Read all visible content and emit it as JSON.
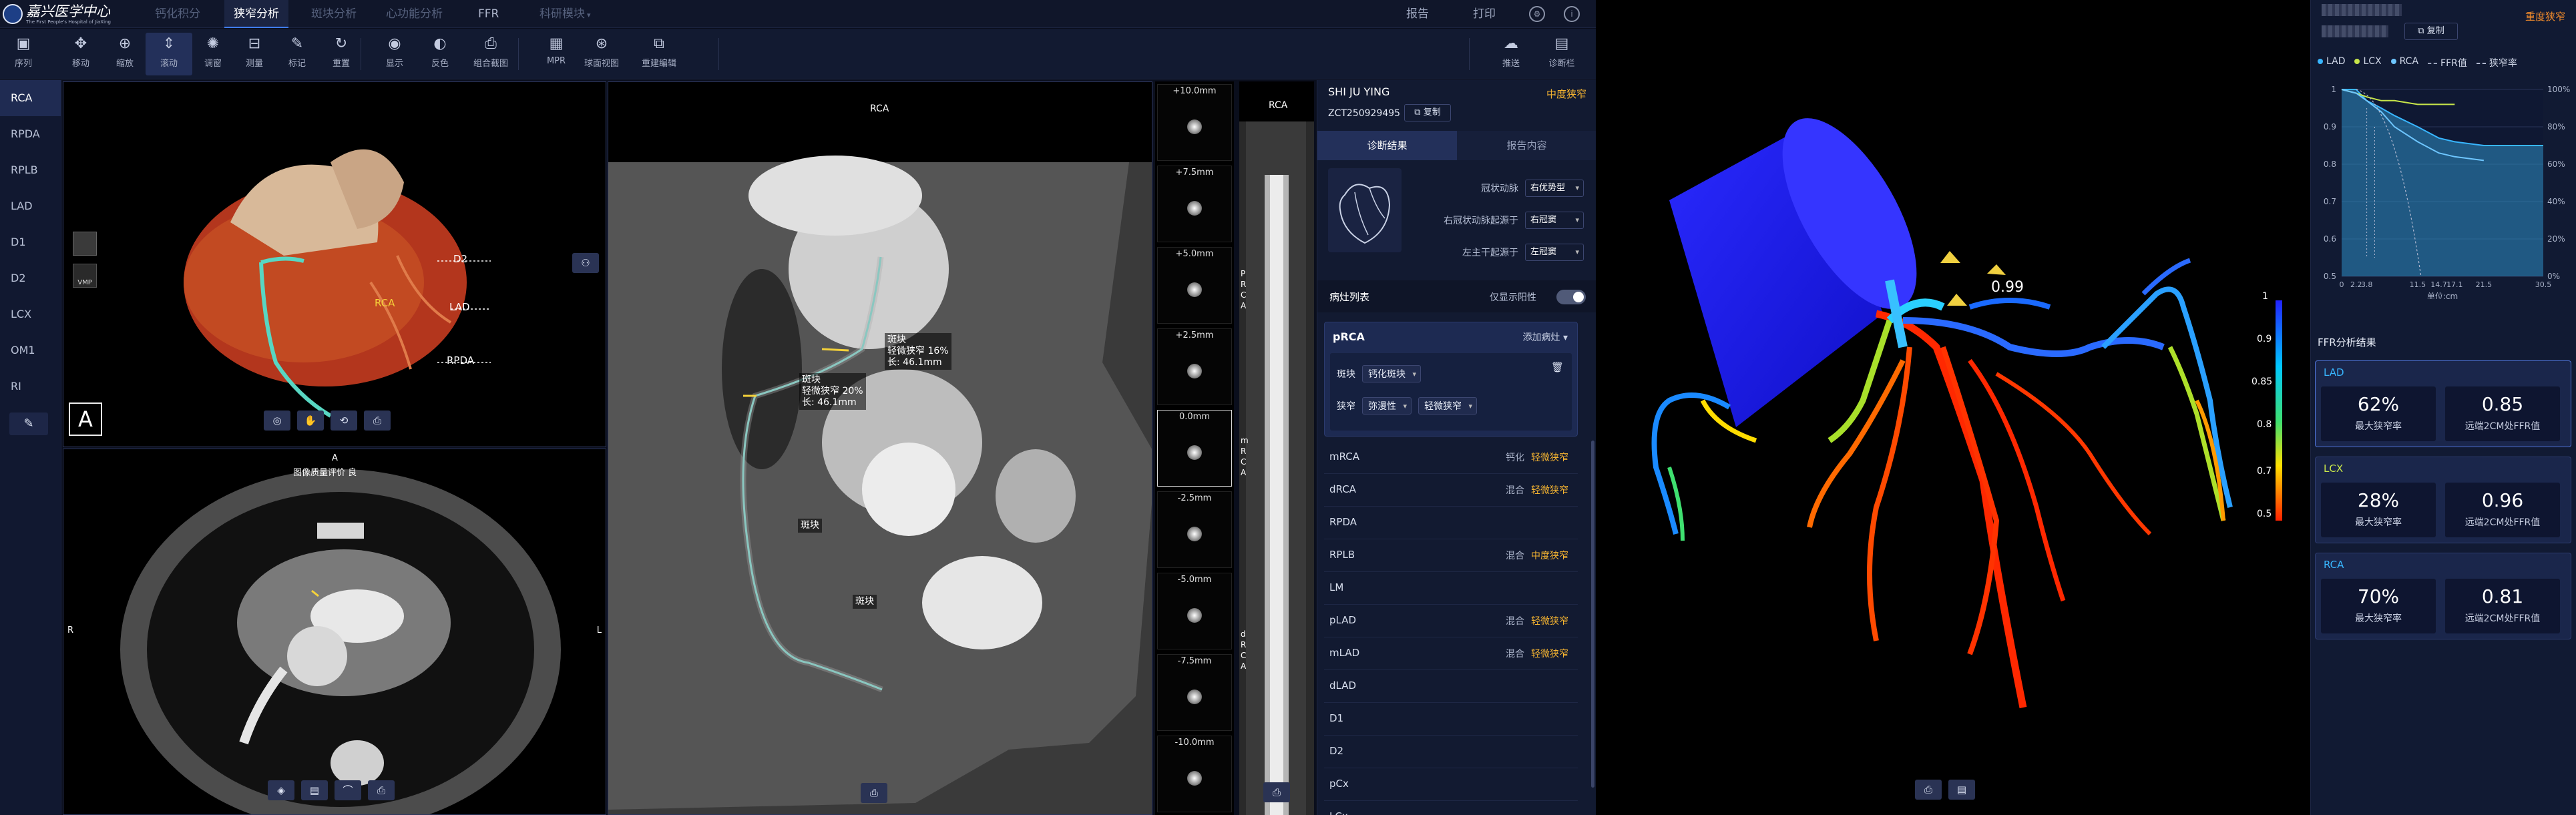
{
  "nav": {
    "logo_name": "嘉兴医学中心",
    "logo_sub": "The First People's Hospital of JiaXing",
    "tabs": [
      "钙化积分",
      "狭窄分析",
      "斑块分析",
      "心功能分析",
      "FFR",
      "科研模块"
    ],
    "right": [
      "报告",
      "打印"
    ]
  },
  "toolbar": [
    {
      "icon": "series-icon",
      "glyph": "▣",
      "label": "序列"
    },
    {
      "icon": "move-icon",
      "glyph": "✥",
      "label": "移动"
    },
    {
      "icon": "zoom-icon",
      "glyph": "⊕",
      "label": "缩放"
    },
    {
      "icon": "scroll-icon",
      "glyph": "⇕",
      "label": "滚动"
    },
    {
      "icon": "adjust-icon",
      "glyph": "✺",
      "label": "调窗"
    },
    {
      "icon": "measure-icon",
      "glyph": "⊟",
      "label": "测量"
    },
    {
      "icon": "annotate-icon",
      "glyph": "✎",
      "label": "标记"
    },
    {
      "icon": "reset-icon",
      "glyph": "↻",
      "label": "重置"
    },
    {
      "icon": "display-icon",
      "glyph": "◉",
      "label": "显示"
    },
    {
      "icon": "invert-icon",
      "glyph": "◐",
      "label": "反色"
    },
    {
      "icon": "screenshot-icon",
      "glyph": "⎙",
      "label": "组合截图"
    },
    {
      "icon": "mpr-icon",
      "glyph": "▦",
      "label": "MPR"
    },
    {
      "icon": "sphere-icon",
      "glyph": "⊛",
      "label": "球面视图"
    },
    {
      "icon": "rebuild-icon",
      "glyph": "⧉",
      "label": "重建编辑"
    },
    {
      "icon": "push-icon",
      "glyph": "☁",
      "label": "推送"
    },
    {
      "icon": "diagnose-icon",
      "glyph": "▤",
      "label": "诊断栏"
    }
  ],
  "vessels": [
    "RCA",
    "RPDA",
    "RPLB",
    "LAD",
    "D1",
    "D2",
    "LCX",
    "OM1",
    "RI"
  ],
  "vr": {
    "labels": {
      "d2": "D2",
      "lad": "LAD",
      "rca": "RCA",
      "rpda": "RPDA"
    },
    "letter": "A",
    "vmp": "VMP"
  },
  "axial": {
    "top": "A",
    "quality": "图像质量评价  良",
    "left": "R",
    "right": "L"
  },
  "cpr": {
    "title": "RCA",
    "plaques": [
      {
        "name": "斑块",
        "steno": "轻微狭窄 16%",
        "len": "长: 46.1mm"
      },
      {
        "name": "斑块",
        "steno": "轻微狭窄 20%",
        "len": "长: 46.1mm"
      },
      {
        "name": "斑块"
      },
      {
        "name": "斑块"
      }
    ]
  },
  "strip": [
    "+10.0mm",
    "+7.5mm",
    "+5.0mm",
    "+2.5mm",
    "0.0mm",
    "-2.5mm",
    "-5.0mm",
    "-7.5mm",
    "-10.0mm"
  ],
  "stretched": {
    "title": "RCA",
    "label_a": "P R C A",
    "label_b": "m R C A",
    "label_c": "d R C A"
  },
  "diag": {
    "patient": "SHI JU YING",
    "pid": "ZCT250929495",
    "copy": "复制",
    "severity": "中度狭窄",
    "tabs": [
      "诊断结果",
      "报告内容"
    ],
    "rows": [
      {
        "k": "冠状动脉",
        "v": "右优势型"
      },
      {
        "k": "右冠状动脉起源于",
        "v": "右冠窦"
      },
      {
        "k": "左主干起源于",
        "v": "左冠窦"
      }
    ],
    "lesion_title": "病灶列表",
    "positive_only": "仅显示阳性",
    "primary": {
      "name": "pRCA",
      "add": "添加病灶 ▾",
      "plaque_k": "斑块",
      "plaque_v": "钙化斑块",
      "steno_k": "狭窄",
      "steno_v1": "弥漫性",
      "steno_v2": "轻微狭窄"
    },
    "lesions": [
      {
        "n": "mRCA",
        "t": "钙化",
        "s": "轻微狭窄"
      },
      {
        "n": "dRCA",
        "t": "混合",
        "s": "轻微狭窄"
      },
      {
        "n": "RPDA",
        "t": "",
        "s": ""
      },
      {
        "n": "RPLB",
        "t": "混合",
        "s": "中度狭窄"
      },
      {
        "n": "LM",
        "t": "",
        "s": ""
      },
      {
        "n": "pLAD",
        "t": "混合",
        "s": "轻微狭窄"
      },
      {
        "n": "mLAD",
        "t": "混合",
        "s": "轻微狭窄"
      },
      {
        "n": "dLAD",
        "t": "",
        "s": ""
      },
      {
        "n": "D1",
        "t": "",
        "s": ""
      },
      {
        "n": "D2",
        "t": "",
        "s": ""
      },
      {
        "n": "pCx",
        "t": "",
        "s": ""
      },
      {
        "n": "LCx",
        "t": "",
        "s": ""
      }
    ]
  },
  "model3d": {
    "ffr_label": "0.99",
    "scale": [
      "1",
      "0.9",
      "0.85",
      "0.8",
      "0.7",
      "0.5"
    ],
    "colors": {
      "low": "#ff2a00",
      "mid": "#ffdd00",
      "high": "#1a1aff"
    }
  },
  "rpanel": {
    "copy": "复制",
    "severity": "重度狭窄",
    "legend": [
      {
        "name": "LAD",
        "color": "#38b6ff"
      },
      {
        "name": "LCX",
        "color": "#c8e64a"
      },
      {
        "name": "RCA",
        "color": "#6ec6ff"
      },
      {
        "name": "FFR值",
        "color": "#9aa3bb"
      },
      {
        "name": "狭窄率",
        "color": "#b0b8d0"
      }
    ],
    "xunit": "单位:cm",
    "ffr_title": "FFR分析结果",
    "cards": [
      {
        "name": "LAD",
        "color": "#38b6ff",
        "steno": "62%",
        "steno_label": "最大狭窄率",
        "ffr": "0.85",
        "ffr_label": "远端2CM处FFR值"
      },
      {
        "name": "LCX",
        "color": "#c8e64a",
        "steno": "28%",
        "steno_label": "最大狭窄率",
        "ffr": "0.96",
        "ffr_label": "远端2CM处FFR值"
      },
      {
        "name": "RCA",
        "color": "#38b6ff",
        "steno": "70%",
        "steno_label": "最大狭窄率",
        "ffr": "0.81",
        "ffr_label": "远端2CM处FFR值"
      }
    ]
  },
  "chart_data": {
    "type": "line",
    "xlabel": "单位:cm",
    "x_ticks": [
      "0",
      "2.2",
      "3.8",
      "11.5",
      "14.7",
      "17.1",
      "21.5",
      "30.5"
    ],
    "y_left_ticks": [
      "0.5",
      "0.6",
      "0.7",
      "0.8",
      "0.9",
      "1"
    ],
    "y_right_ticks": [
      "0%",
      "20%",
      "40%",
      "60%",
      "80%",
      "100%"
    ],
    "series": [
      {
        "name": "LAD",
        "x": [
          0,
          2.2,
          3.8,
          6,
          8,
          11.5,
          14.7,
          17.1,
          21.5,
          30.5
        ],
        "y": [
          1,
          1,
          0.97,
          0.95,
          0.93,
          0.9,
          0.87,
          0.86,
          0.85,
          0.85
        ]
      },
      {
        "name": "LCX",
        "x": [
          0,
          2.2,
          3.8,
          6,
          8,
          11.5,
          14.7,
          17.1
        ],
        "y": [
          1,
          0.99,
          0.98,
          0.97,
          0.97,
          0.96,
          0.96,
          0.96
        ]
      },
      {
        "name": "RCA",
        "x": [
          0,
          2.2,
          3.8,
          6,
          8,
          11.5,
          14.7,
          17.1,
          21.5
        ],
        "y": [
          1,
          0.99,
          0.97,
          0.94,
          0.9,
          0.86,
          0.83,
          0.82,
          0.81
        ]
      }
    ]
  }
}
